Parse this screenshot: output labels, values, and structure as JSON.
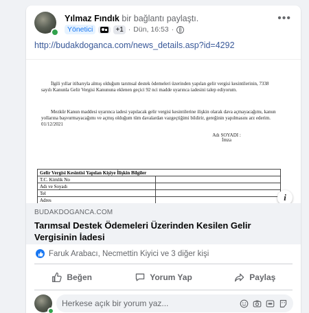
{
  "post": {
    "author": "Yılmaz Fındık",
    "action": "bir bağlantı paylaştı.",
    "role_badge": "Yönetici",
    "badge_count": "+1",
    "time": "Dün, 16:53",
    "separator": "·",
    "link_url": "http://budakdoganca.com/news_details.asp?id=4292"
  },
  "document": {
    "paragraph1": "İlgili yıllar itibarıyla almış olduğum tarımsal destek ödemeleri üzerinden yapılan gelir vergisi kesintilerinin, 7338 sayılı Kanunla Gelir Vergisi Kanununa eklenen geçici 92 nci madde uyarınca iadesini talep ediyorum.",
    "paragraph2": "Mezkûr Kanun maddesi uyarınca iadesi yapılacak gelir vergisi kesintilerine ilişkin olarak dava açmayacağımı, kanun yollarına başvurmayacağımı ve açmış olduğum tüm davalardan vazgeçtiğimi bildirir, gereğinin yapılmasını arz ederim. 01/12/2021",
    "signature_name": "Adı SOYADI :",
    "signature_label": "İmza",
    "table_header": "Gelir Vergisi Kesintisi Yapılan Kişiye İlişkin Bilgiler",
    "table_rows": [
      "T.C. Kimlik No",
      "Adı ve Soyadı",
      "Tel",
      "Adres"
    ]
  },
  "preview": {
    "domain": "BUDAKDOGANCA.COM",
    "title": "Tarımsal Destek Ödemeleri Üzerinden Kesilen Gelir Vergisinin İadesi"
  },
  "reactions": {
    "text": "Faruk Arabacı, Necmettin Kiyici ve 3 diğer kişi"
  },
  "actions": {
    "like": "Beğen",
    "comment": "Yorum Yap",
    "share": "Paylaş"
  },
  "comment_input": {
    "placeholder": "Herkese açık bir yorum yaz..."
  },
  "colors": {
    "link": "#385898",
    "accent": "#1877f2",
    "online": "#31a24c",
    "muted": "#65676b"
  }
}
